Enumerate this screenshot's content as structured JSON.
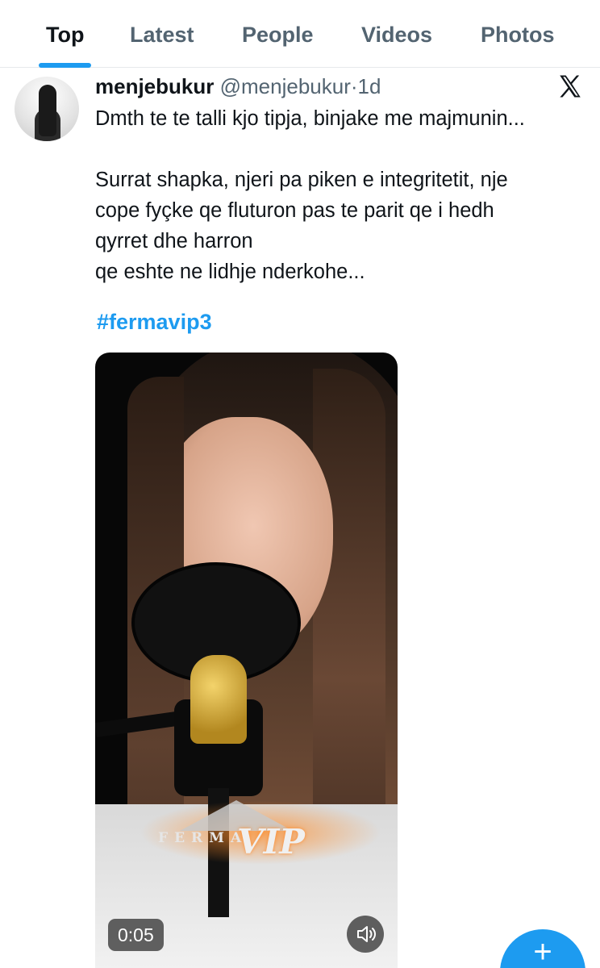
{
  "tabs": [
    {
      "label": "Top",
      "active": true
    },
    {
      "label": "Latest",
      "active": false
    },
    {
      "label": "People",
      "active": false
    },
    {
      "label": "Videos",
      "active": false
    },
    {
      "label": "Photos",
      "active": false
    }
  ],
  "tweet": {
    "display_name": "menjebukur",
    "handle": "@menjebukur",
    "separator": "·",
    "time": "1d",
    "source_icon": "x-logo-icon",
    "text": "Dmth te te talli kjo tipja, binjake me majmunin...\n\nSurrat shapka, njeri pa piken e integritetit, nje\ncope fyçke qe fluturon pas te parit qe i hedh\nqyrret dhe harron\nqe eshte ne lidhje nderkohe...",
    "hashtag": "#fermavip3",
    "media": {
      "type": "video",
      "duration": "0:05",
      "overlay_logo_text": "FERMA",
      "overlay_logo_vip": "VIP",
      "mute_icon": "speaker-muted-icon"
    }
  },
  "fab": {
    "label": "+",
    "icon": "compose-plus-icon"
  },
  "colors": {
    "accent": "#1d9bf0",
    "text_primary": "#0f1419",
    "text_secondary": "#536471",
    "divider": "#e6e9ec"
  }
}
